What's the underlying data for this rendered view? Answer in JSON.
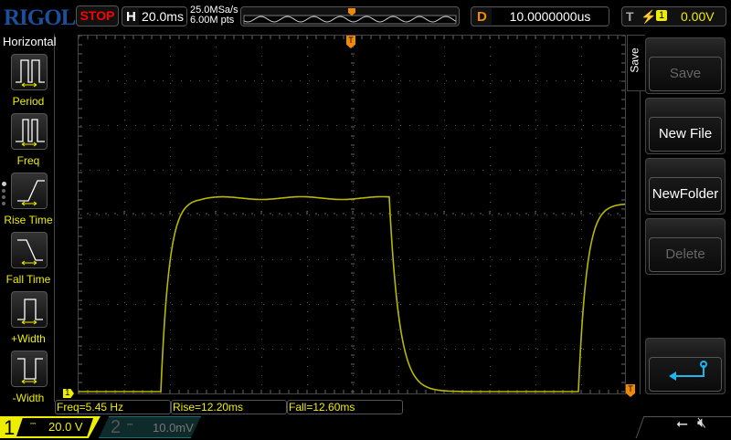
{
  "header": {
    "brand": "RIGOL",
    "run_state": "STOP",
    "h_label": "H",
    "timebase": "20.0ms",
    "sample_rate": "25.0MSa/s",
    "mem_depth": "6.00M pts",
    "d_label": "D",
    "delay": "10.0000000us",
    "t_label": "T",
    "trig_channel": "1",
    "trig_level": "0.00V"
  },
  "left_menu": {
    "title": "Horizontal",
    "items": [
      {
        "label": "Period"
      },
      {
        "label": "Freq"
      },
      {
        "label": "Rise Time"
      },
      {
        "label": "Fall Time"
      },
      {
        "label": "+Width"
      },
      {
        "label": "-Width"
      }
    ]
  },
  "right_menu": {
    "title": "Save",
    "items": [
      {
        "label": "Save",
        "enabled": false
      },
      {
        "label": "New File",
        "enabled": true
      },
      {
        "label": "NewFolder",
        "enabled": true
      },
      {
        "label": "Delete",
        "enabled": false
      }
    ]
  },
  "measurements": [
    "Freq=5.45 Hz",
    "Rise=12.20ms",
    "Fall=12.60ms"
  ],
  "channels": [
    {
      "num": "1",
      "coupling": "DC",
      "scale": "20.0 V",
      "color": "#f0f000"
    },
    {
      "num": "2",
      "coupling": "DC",
      "scale": "10.0mV",
      "color": "#1e6e6e"
    }
  ],
  "markers": {
    "ch1": "1",
    "trigger": "T"
  }
}
